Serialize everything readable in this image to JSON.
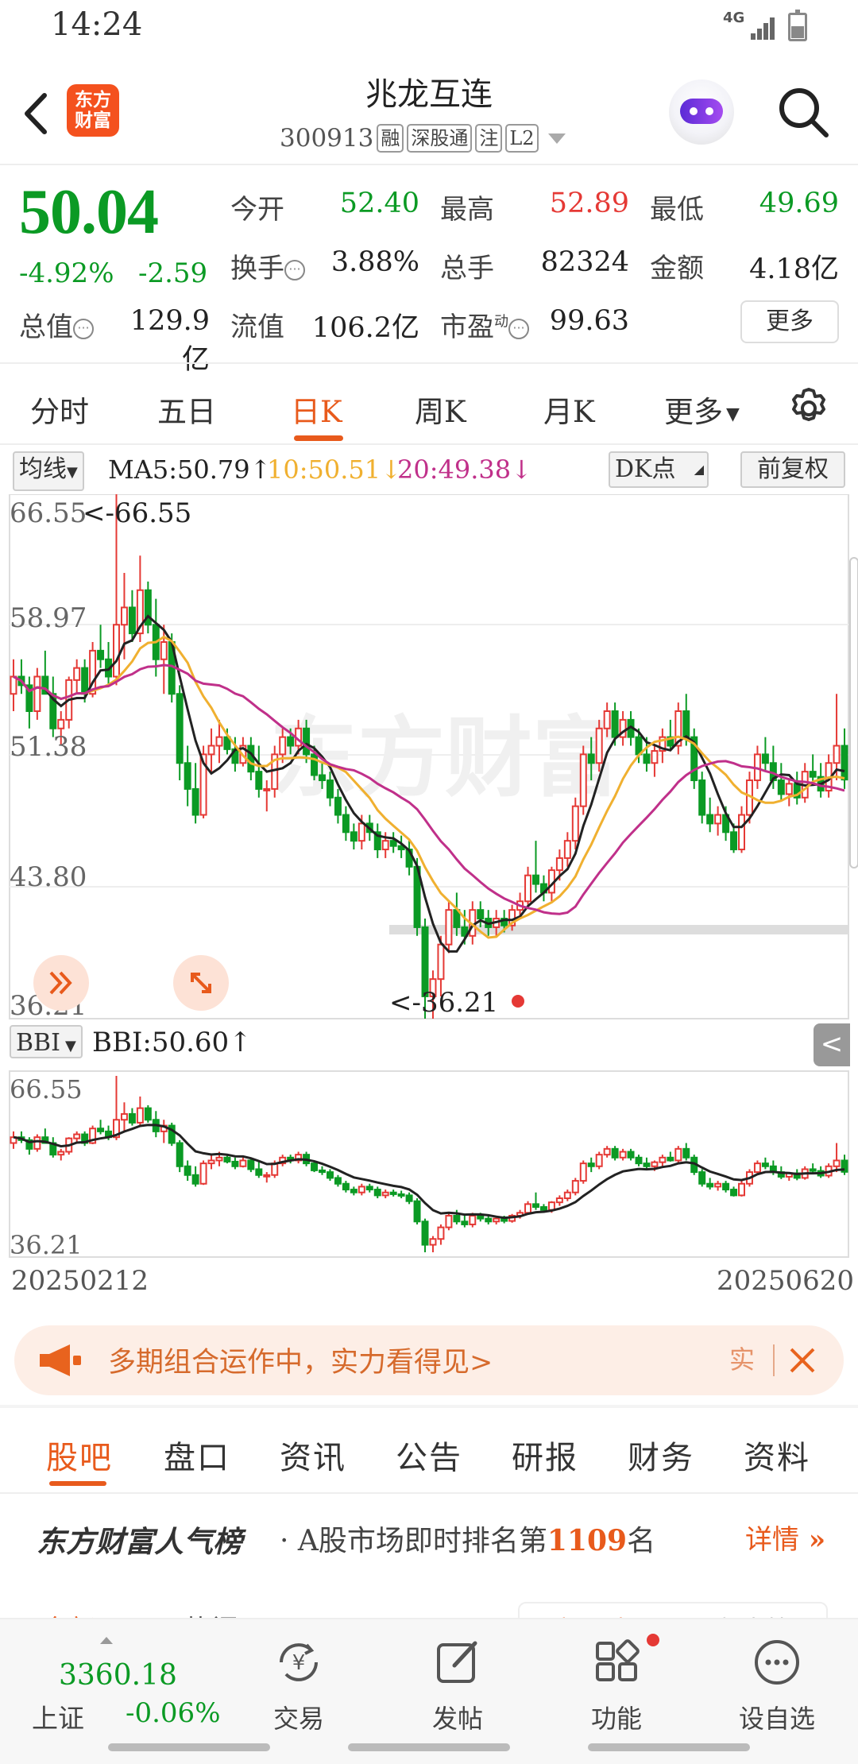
{
  "status_bar": {
    "time": "14:24",
    "network": "4G"
  },
  "header": {
    "stock_name": "兆龙互连",
    "stock_code": "300913",
    "tags": [
      "融",
      "深股通",
      "注",
      "L2"
    ],
    "logo_text": [
      "东方",
      "财富"
    ]
  },
  "quote": {
    "price": "50.04",
    "change_pct": "-4.92%",
    "change_amt": "-2.59",
    "open_label": "今开",
    "open": "52.40",
    "high_label": "最高",
    "high": "52.89",
    "low_label": "最低",
    "low": "49.69",
    "turnover_label": "换手",
    "turnover": "3.88%",
    "volume_label": "总手",
    "volume": "82324",
    "amount_label": "金额",
    "amount": "4.18亿",
    "mktcap_label": "总值",
    "mktcap": "129.9亿",
    "float_label": "流值",
    "float_cap": "106.2亿",
    "pe_label": "市盈",
    "pe_sup": "动",
    "pe": "99.63",
    "more": "更多"
  },
  "kline_tabs": {
    "items": [
      "分时",
      "五日",
      "日K",
      "周K",
      "月K",
      "更多"
    ],
    "active": "日K"
  },
  "indicators": {
    "selector": "均线",
    "ma5": "MA5:50.79↑",
    "ma10": "10:50.51↓",
    "ma20": "20:49.38↓",
    "dk": "DK点",
    "adjust": "前复权",
    "colors": {
      "ma5": "#222222",
      "ma10": "#f0b030",
      "ma20": "#c0308a",
      "up": "#e53935",
      "down": "#0b9a24"
    }
  },
  "chart_data": {
    "type": "candlestick",
    "main_axis": {
      "top": "66.55",
      "upper": "58.97",
      "mid": "51.38",
      "lower": "43.80",
      "bottom": "36.21",
      "ylim": [
        36.21,
        66.55
      ]
    },
    "max_marker": "<-66.55",
    "min_marker": "<-36.21",
    "sub_indicator": "BBI",
    "bbi_value": "BBI:50.60↑",
    "sub_axis": {
      "top": "66.55",
      "bottom": "36.21"
    },
    "x_start": "20250212",
    "x_end": "20250620",
    "ohlc": [
      [
        55,
        57,
        54,
        56
      ],
      [
        56,
        57,
        55,
        55.5
      ],
      [
        55.5,
        56,
        53,
        54
      ],
      [
        54,
        56.5,
        53.5,
        56
      ],
      [
        56,
        57.5,
        55,
        55
      ],
      [
        55,
        56,
        52.5,
        53
      ],
      [
        53,
        54,
        52,
        53.5
      ],
      [
        53.5,
        56,
        53,
        55.8
      ],
      [
        55.8,
        57,
        55,
        56.5
      ],
      [
        56.5,
        57,
        54.5,
        55
      ],
      [
        55,
        58,
        54.8,
        57.5
      ],
      [
        57.5,
        59,
        56.5,
        57
      ],
      [
        57,
        58,
        55.5,
        56
      ],
      [
        56,
        66.55,
        55.5,
        59
      ],
      [
        59,
        62,
        57,
        60
      ],
      [
        60,
        61,
        58,
        58.5
      ],
      [
        58.5,
        63,
        58,
        61
      ],
      [
        61,
        61.5,
        58.5,
        59
      ],
      [
        59,
        60.5,
        56,
        57
      ],
      [
        57,
        59,
        55,
        58
      ],
      [
        58,
        58.5,
        54.5,
        55
      ],
      [
        55,
        55.5,
        50,
        51
      ],
      [
        51,
        52,
        48.5,
        49.5
      ],
      [
        49.5,
        51,
        47.5,
        48
      ],
      [
        48,
        52,
        47.8,
        51.5
      ],
      [
        51.5,
        53,
        50.5,
        52
      ],
      [
        52,
        53.5,
        51,
        52.5
      ],
      [
        52.5,
        53,
        51.5,
        51.8
      ],
      [
        51.8,
        52.5,
        50.5,
        51
      ],
      [
        51,
        52.5,
        50.8,
        52
      ],
      [
        52,
        52.5,
        50,
        50.5
      ],
      [
        50.5,
        52,
        49,
        49.5
      ],
      [
        49.5,
        50,
        48.2,
        49.5
      ],
      [
        49.5,
        52,
        49,
        51.5
      ],
      [
        51.5,
        53,
        51,
        52.5
      ],
      [
        52.5,
        53,
        51.5,
        52
      ],
      [
        52,
        53.5,
        51.5,
        53
      ],
      [
        53,
        53.5,
        51,
        51.5
      ],
      [
        51.5,
        52,
        50,
        50.3
      ],
      [
        50.3,
        51,
        49.5,
        50
      ],
      [
        50,
        50.5,
        48.5,
        49
      ],
      [
        49,
        49.5,
        47.5,
        48
      ],
      [
        48,
        48.5,
        46.5,
        47
      ],
      [
        47,
        47.5,
        46,
        46.5
      ],
      [
        46.5,
        48,
        46,
        47.5
      ],
      [
        47.5,
        48,
        46.5,
        47
      ],
      [
        47,
        47.5,
        45.5,
        46
      ],
      [
        46,
        47,
        45.5,
        46.5
      ],
      [
        46.5,
        47,
        45.8,
        46.2
      ],
      [
        46.2,
        46.8,
        45.5,
        46
      ],
      [
        46,
        46.5,
        44.5,
        45
      ],
      [
        45,
        45.5,
        41,
        41.5
      ],
      [
        41.5,
        42,
        36.21,
        37.5
      ],
      [
        37.5,
        39,
        36.21,
        38.5
      ],
      [
        38.5,
        41,
        37.5,
        40.5
      ],
      [
        40.5,
        43,
        40,
        42.5
      ],
      [
        42.5,
        43.5,
        41,
        41.5
      ],
      [
        41.5,
        42.5,
        40.5,
        41
      ],
      [
        41,
        43,
        40.5,
        42.5
      ],
      [
        42.5,
        43,
        41.5,
        42
      ],
      [
        42,
        42.5,
        41,
        41.5
      ],
      [
        41.5,
        42.5,
        41,
        42
      ],
      [
        42,
        42.5,
        41.2,
        41.6
      ],
      [
        41.6,
        42.8,
        41.3,
        42.5
      ],
      [
        42.5,
        43.5,
        42,
        43
      ],
      [
        43,
        45,
        42.8,
        44.5
      ],
      [
        44.5,
        46.5,
        43.5,
        44
      ],
      [
        44,
        44.5,
        43,
        43.5
      ],
      [
        43.5,
        45,
        43,
        44.8
      ],
      [
        44.8,
        46,
        44.2,
        45.5
      ],
      [
        45.5,
        47,
        45,
        46.5
      ],
      [
        46.5,
        49,
        46,
        48.5
      ],
      [
        48.5,
        52,
        48,
        51.5
      ],
      [
        51.5,
        52.5,
        50,
        51
      ],
      [
        51,
        53.5,
        50.5,
        53
      ],
      [
        53,
        54.5,
        52.5,
        54
      ],
      [
        54,
        54.5,
        52,
        52.5
      ],
      [
        52.5,
        54,
        52,
        53.5
      ],
      [
        53.5,
        54,
        52,
        52.5
      ],
      [
        52.5,
        53,
        51,
        51.5
      ],
      [
        51.5,
        52.5,
        50.5,
        51
      ],
      [
        51,
        52,
        50.2,
        51.7
      ],
      [
        51.7,
        53,
        51,
        52.5
      ],
      [
        52.5,
        53.5,
        51.8,
        52
      ],
      [
        52,
        54.5,
        51.5,
        54
      ],
      [
        54,
        55,
        52,
        52.5
      ],
      [
        52.5,
        53,
        49.5,
        50
      ],
      [
        50,
        50.5,
        47.5,
        48
      ],
      [
        48,
        49,
        47,
        47.5
      ],
      [
        47.5,
        48.5,
        46.8,
        48
      ],
      [
        48,
        48.5,
        46.5,
        47
      ],
      [
        47,
        47.5,
        45.8,
        46
      ],
      [
        46,
        48.5,
        45.8,
        48
      ],
      [
        48,
        50.5,
        47.5,
        50
      ],
      [
        50,
        52,
        49.5,
        51.5
      ],
      [
        51.5,
        52.5,
        50.5,
        51
      ],
      [
        51,
        52,
        49.5,
        50
      ],
      [
        50,
        51,
        48.8,
        49.2
      ],
      [
        49.2,
        50,
        48.5,
        49.8
      ],
      [
        49.8,
        50.5,
        48.6,
        49
      ],
      [
        49,
        51,
        48.7,
        50.5
      ],
      [
        50.5,
        51.5,
        49.8,
        50.2
      ],
      [
        50.2,
        51,
        49,
        49.4
      ],
      [
        49.4,
        51.5,
        49,
        51
      ],
      [
        51,
        55,
        50,
        52
      ],
      [
        52,
        53,
        49.5,
        50.04
      ]
    ]
  },
  "chart_side_labels": {
    "collapse": "<"
  },
  "ad": {
    "text": "多期组合运作中，实力看得见>",
    "tail": "实"
  },
  "main_tabs": {
    "items": [
      "股吧",
      "盘口",
      "资讯",
      "公告",
      "研报",
      "财务",
      "资料"
    ],
    "active": "股吧"
  },
  "rank": {
    "brand": "东方财富人气榜",
    "prefix": "· A股市场即时排名第",
    "number": "1109",
    "suffix": "名",
    "detail": "详情"
  },
  "sub_peek": {
    "left_a": "全部",
    "left_b": "热门",
    "right_a": "最新评论",
    "right_b": "最新发帖"
  },
  "bottom_nav": {
    "index_value": "3360.18",
    "index_name": "上证",
    "index_pct": "-0.06%",
    "items": [
      "交易",
      "发帖",
      "功能",
      "设自选"
    ]
  }
}
